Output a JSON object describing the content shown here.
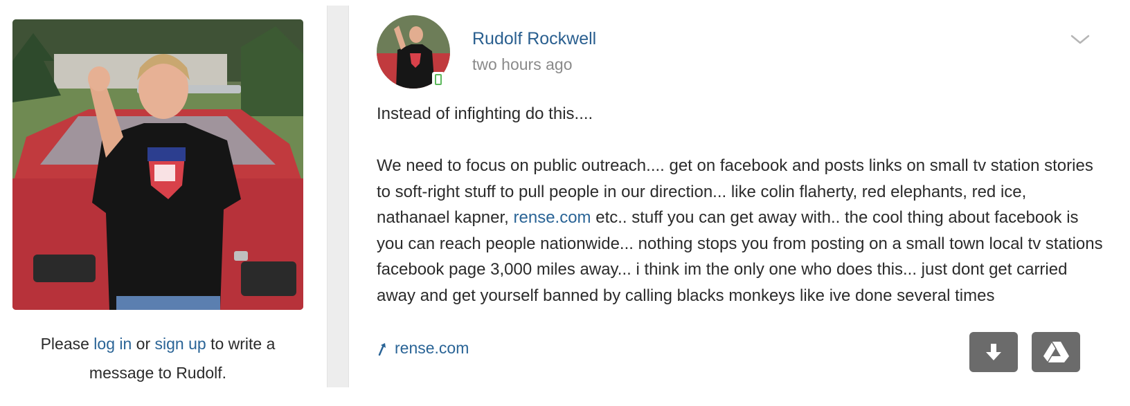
{
  "sidebar": {
    "profile_photo_alt": "profile-photo",
    "login_note": {
      "prefix": "Please ",
      "login_link": "log in",
      "middle": " or ",
      "signup_link": "sign up",
      "suffix": " to write a",
      "line2": "message to Rudolf."
    }
  },
  "post": {
    "author": "Rudolf Rockwell",
    "time": "two hours ago",
    "paragraph1": "Instead of infighting do this....",
    "paragraph2_before_link": "We need to focus on public outreach.... get on facebook and posts links on small tv station stories to soft-right stuff to pull people in our direction... like colin flaherty, red elephants, red ice, nathanael kapner, ",
    "paragraph2_link": "rense.com",
    "paragraph2_after_link": " etc.. stuff you can get away with.. the cool thing about facebook is you can reach people nationwide... nothing stops you from posting on a small town local tv stations facebook page 3,000 miles away... i think im the only one who does this... just dont get carried away and get yourself banned by calling blacks monkeys like ive done several times",
    "link_preview": "rense.com",
    "icons": {
      "menu": "chevron-down-icon",
      "link": "link-arrow-icon",
      "download": "download-icon",
      "drive": "google-drive-icon",
      "device": "mobile-device-icon"
    }
  },
  "colors": {
    "link": "#2a6496",
    "author": "#2a5f8f",
    "muted": "#8a8a8a",
    "button": "#6b6b6b",
    "divider": "#ededed"
  }
}
